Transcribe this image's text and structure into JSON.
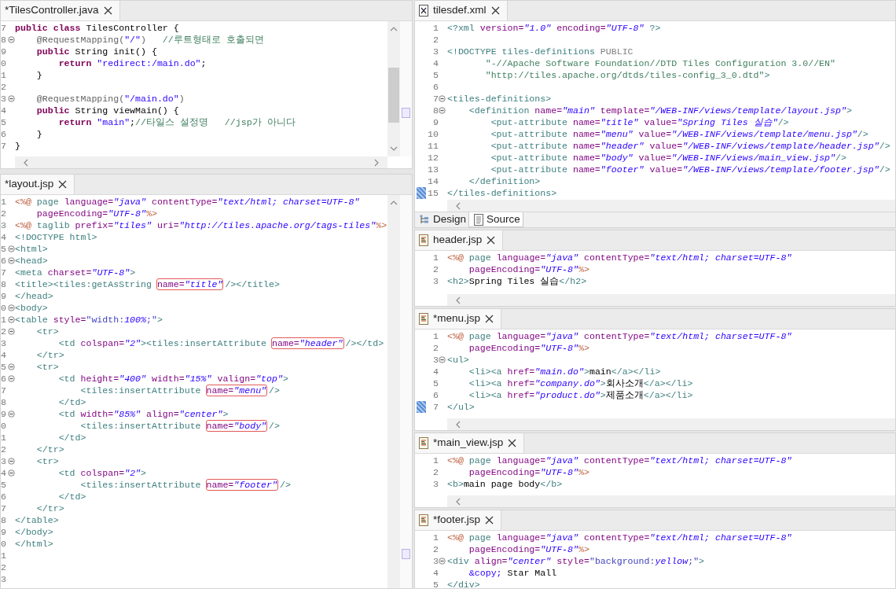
{
  "columns": [
    {
      "editors": [
        {
          "tab": {
            "label": "*TilesController.java"
          },
          "lines": [
            {
              "number": "7",
              "fold": false,
              "segs": [
                {
                  "text": "public class ",
                  "kind": "k"
                },
                {
                  "text": "TilesController {",
                  "kind": "p"
                }
              ]
            },
            {
              "number": "8",
              "fold": true,
              "segs": [
                {
                  "text": "    @RequestMapping(",
                  "kind": "an"
                },
                {
                  "text": "\"/\"",
                  "kind": "js"
                },
                {
                  "text": ")",
                  "kind": "an"
                },
                {
                  "text": "   //루트형태로 호출되면",
                  "kind": "c"
                }
              ]
            },
            {
              "number": "9",
              "fold": false,
              "segs": [
                {
                  "text": "    public",
                  "kind": "k"
                },
                {
                  "text": " String init() {",
                  "kind": "p"
                }
              ]
            },
            {
              "number": "0",
              "fold": false,
              "segs": [
                {
                  "text": "        return",
                  "kind": "k"
                },
                {
                  "text": " \"redirect:/main.do\"",
                  "kind": "js"
                },
                {
                  "text": ";",
                  "kind": "p"
                }
              ]
            },
            {
              "number": "1",
              "fold": false,
              "segs": [
                {
                  "text": "    }",
                  "kind": "p"
                }
              ]
            },
            {
              "number": "2",
              "fold": false
            },
            {
              "number": "3",
              "fold": true,
              "segs": [
                {
                  "text": "    @RequestMapping(",
                  "kind": "an"
                },
                {
                  "text": "\"/main.do\"",
                  "kind": "js"
                },
                {
                  "text": ")",
                  "kind": "an"
                }
              ]
            },
            {
              "number": "4",
              "fold": false,
              "segs": [
                {
                  "text": "    public",
                  "kind": "k"
                },
                {
                  "text": " String viewMain() {",
                  "kind": "p"
                }
              ]
            },
            {
              "number": "5",
              "fold": false,
              "segs": [
                {
                  "text": "        return",
                  "kind": "k"
                },
                {
                  "text": " \"main\"",
                  "kind": "js"
                },
                {
                  "text": ";",
                  "kind": "p"
                },
                {
                  "text": "//타일스 설정명   //jsp가 아니다",
                  "kind": "c"
                }
              ]
            },
            {
              "number": "6",
              "fold": false,
              "segs": [
                {
                  "text": "    }",
                  "kind": "p"
                }
              ]
            },
            {
              "number": "7",
              "fold": false,
              "segs": [
                {
                  "text": "}",
                  "kind": "p"
                }
              ]
            }
          ]
        },
        {
          "tab": {
            "label": "*layout.jsp"
          },
          "lines": [
            {
              "number": "1",
              "fold": false,
              "segs": [
                {
                  "text": "<%@ ",
                  "kind": "d"
                },
                {
                  "text": "page ",
                  "kind": "tag"
                },
                {
                  "text": "language=",
                  "kind": "at"
                },
                {
                  "text": "\"java\" ",
                  "kind": "s"
                },
                {
                  "text": "contentType=",
                  "kind": "at"
                },
                {
                  "text": "\"text/html; charset=UTF-8\"",
                  "kind": "s"
                }
              ]
            },
            {
              "number": "2",
              "fold": false,
              "segs": [
                {
                  "text": "    pageEncoding=",
                  "kind": "at"
                },
                {
                  "text": "\"UTF-8\"",
                  "kind": "s"
                },
                {
                  "text": "%>",
                  "kind": "d"
                }
              ]
            },
            {
              "number": "3",
              "fold": false,
              "segs": [
                {
                  "text": "<%@ ",
                  "kind": "d"
                },
                {
                  "text": "taglib ",
                  "kind": "tag"
                },
                {
                  "text": "prefix=",
                  "kind": "at"
                },
                {
                  "text": "\"tiles\" ",
                  "kind": "s"
                },
                {
                  "text": "uri=",
                  "kind": "at"
                },
                {
                  "text": "\"http://tiles.apache.org/tags-tiles\"",
                  "kind": "s"
                },
                {
                  "text": "%>",
                  "kind": "d"
                }
              ]
            },
            {
              "number": "4",
              "fold": false,
              "segs": [
                {
                  "text": "<!DOCTYPE html>",
                  "kind": "tag"
                }
              ]
            },
            {
              "number": "5",
              "fold": true,
              "segs": [
                {
                  "text": "<html>",
                  "kind": "tag"
                }
              ]
            },
            {
              "number": "6",
              "fold": true,
              "segs": [
                {
                  "text": "<head>",
                  "kind": "tag"
                }
              ]
            },
            {
              "number": "7",
              "fold": false,
              "segs": [
                {
                  "text": "<meta ",
                  "kind": "tag"
                },
                {
                  "text": "charset=",
                  "kind": "at"
                },
                {
                  "text": "\"UTF-8\"",
                  "kind": "s"
                },
                {
                  "text": ">",
                  "kind": "tag"
                }
              ]
            },
            {
              "number": "8",
              "fold": false,
              "segs": [
                {
                  "text": "<title><tiles:getAsString ",
                  "kind": "tag"
                },
                {
                  "kind": "box",
                  "segs": [
                    {
                      "text": "name=",
                      "kind": "at"
                    },
                    {
                      "text": "\"title\"",
                      "kind": "s"
                    }
                  ]
                },
                {
                  "text": "/></title>",
                  "kind": "tag"
                }
              ]
            },
            {
              "number": "9",
              "fold": false,
              "segs": [
                {
                  "text": "</head>",
                  "kind": "tag"
                }
              ]
            },
            {
              "number": "0",
              "fold": true,
              "segs": [
                {
                  "text": "<body>",
                  "kind": "tag"
                }
              ]
            },
            {
              "number": "1",
              "fold": true,
              "segs": [
                {
                  "text": "<table ",
                  "kind": "tag"
                },
                {
                  "text": "style=",
                  "kind": "at"
                },
                {
                  "text": "\"width:",
                  "kind": "sv"
                },
                {
                  "text": "100%",
                  "kind": "s"
                },
                {
                  "text": ";\"",
                  "kind": "sv"
                },
                {
                  "text": ">",
                  "kind": "tag"
                }
              ]
            },
            {
              "number": "2",
              "fold": true,
              "segs": [
                {
                  "text": "    <tr>",
                  "kind": "tag"
                }
              ]
            },
            {
              "number": "3",
              "fold": false,
              "segs": [
                {
                  "text": "        <td ",
                  "kind": "tag"
                },
                {
                  "text": "colspan=",
                  "kind": "at"
                },
                {
                  "text": "\"2\"",
                  "kind": "s"
                },
                {
                  "text": "><tiles:insertAttribute ",
                  "kind": "tag"
                },
                {
                  "kind": "box",
                  "segs": [
                    {
                      "text": "name=",
                      "kind": "at"
                    },
                    {
                      "text": "\"header\"",
                      "kind": "s"
                    }
                  ]
                },
                {
                  "text": "/></td>",
                  "kind": "tag"
                }
              ]
            },
            {
              "number": "4",
              "fold": false,
              "segs": [
                {
                  "text": "    </tr>",
                  "kind": "tag"
                }
              ]
            },
            {
              "number": "5",
              "fold": true,
              "segs": [
                {
                  "text": "    <tr>",
                  "kind": "tag"
                }
              ]
            },
            {
              "number": "6",
              "fold": true,
              "segs": [
                {
                  "text": "        <td ",
                  "kind": "tag"
                },
                {
                  "text": "height=",
                  "kind": "at"
                },
                {
                  "text": "\"400\" ",
                  "kind": "s"
                },
                {
                  "text": "width=",
                  "kind": "at"
                },
                {
                  "text": "\"15%\" ",
                  "kind": "s"
                },
                {
                  "text": "valign=",
                  "kind": "at"
                },
                {
                  "text": "\"top\"",
                  "kind": "s"
                },
                {
                  "text": ">",
                  "kind": "tag"
                }
              ]
            },
            {
              "number": "7",
              "fold": false,
              "segs": [
                {
                  "text": "            <tiles:insertAttribute ",
                  "kind": "tag"
                },
                {
                  "kind": "box",
                  "segs": [
                    {
                      "text": "name=",
                      "kind": "at"
                    },
                    {
                      "text": "\"menu\"",
                      "kind": "s"
                    }
                  ]
                },
                {
                  "text": "/>",
                  "kind": "tag"
                }
              ]
            },
            {
              "number": "8",
              "fold": false,
              "segs": [
                {
                  "text": "        </td>",
                  "kind": "tag"
                }
              ]
            },
            {
              "number": "9",
              "fold": true,
              "segs": [
                {
                  "text": "        <td ",
                  "kind": "tag"
                },
                {
                  "text": "width=",
                  "kind": "at"
                },
                {
                  "text": "\"85%\" ",
                  "kind": "s"
                },
                {
                  "text": "align=",
                  "kind": "at"
                },
                {
                  "text": "\"center\"",
                  "kind": "s"
                },
                {
                  "text": ">",
                  "kind": "tag"
                }
              ]
            },
            {
              "number": "0",
              "fold": false,
              "segs": [
                {
                  "text": "            <tiles:insertAttribute ",
                  "kind": "tag"
                },
                {
                  "kind": "box",
                  "segs": [
                    {
                      "text": "name=",
                      "kind": "at"
                    },
                    {
                      "text": "\"body\"",
                      "kind": "s"
                    }
                  ]
                },
                {
                  "text": "/>",
                  "kind": "tag"
                }
              ]
            },
            {
              "number": "1",
              "fold": false,
              "segs": [
                {
                  "text": "        </td>",
                  "kind": "tag"
                }
              ]
            },
            {
              "number": "2",
              "fold": false,
              "segs": [
                {
                  "text": "    </tr>",
                  "kind": "tag"
                }
              ]
            },
            {
              "number": "3",
              "fold": true,
              "segs": [
                {
                  "text": "    <tr>",
                  "kind": "tag"
                }
              ]
            },
            {
              "number": "4",
              "fold": true,
              "segs": [
                {
                  "text": "        <td ",
                  "kind": "tag"
                },
                {
                  "text": "colspan=",
                  "kind": "at"
                },
                {
                  "text": "\"2\"",
                  "kind": "s"
                },
                {
                  "text": ">",
                  "kind": "tag"
                }
              ]
            },
            {
              "number": "5",
              "fold": false,
              "segs": [
                {
                  "text": "            <tiles:insertAttribute ",
                  "kind": "tag"
                },
                {
                  "kind": "box",
                  "segs": [
                    {
                      "text": "name=",
                      "kind": "at"
                    },
                    {
                      "text": "\"footer\"",
                      "kind": "s"
                    }
                  ]
                },
                {
                  "text": "/>",
                  "kind": "tag"
                }
              ]
            },
            {
              "number": "6",
              "fold": false,
              "segs": [
                {
                  "text": "        </td>",
                  "kind": "tag"
                }
              ]
            },
            {
              "number": "7",
              "fold": false,
              "segs": [
                {
                  "text": "    </tr>",
                  "kind": "tag"
                }
              ]
            },
            {
              "number": "8",
              "fold": false,
              "segs": [
                {
                  "text": "</table>",
                  "kind": "tag"
                }
              ]
            },
            {
              "number": "9",
              "fold": false,
              "segs": [
                {
                  "text": "</body>",
                  "kind": "tag"
                }
              ]
            },
            {
              "number": "0",
              "fold": false,
              "segs": [
                {
                  "text": "</html>",
                  "kind": "tag"
                }
              ]
            },
            {
              "number": "1",
              "fold": false
            },
            {
              "number": "2",
              "fold": false
            },
            {
              "number": "3",
              "fold": false
            }
          ]
        }
      ]
    },
    {
      "editors": [
        {
          "tab": {
            "label": "tilesdef.xml"
          },
          "lines": [
            {
              "number": "1",
              "fold": false,
              "changed": false,
              "segs": [
                {
                  "text": "<?xml ",
                  "kind": "tag"
                },
                {
                  "text": "version=",
                  "kind": "at"
                },
                {
                  "text": "\"1.0\" ",
                  "kind": "s"
                },
                {
                  "text": "encoding=",
                  "kind": "at"
                },
                {
                  "text": "\"UTF-8\" ",
                  "kind": "s"
                },
                {
                  "text": "?>",
                  "kind": "tag"
                }
              ]
            },
            {
              "number": "2",
              "fold": false,
              "changed": false
            },
            {
              "number": "3",
              "fold": false,
              "changed": false,
              "segs": [
                {
                  "text": "<!DOCTYPE tiles-definitions ",
                  "kind": "tag"
                },
                {
                  "text": "PUBLIC",
                  "kind": "g"
                }
              ]
            },
            {
              "number": "4",
              "fold": false,
              "changed": false,
              "segs": [
                {
                  "text": "       \"-//Apache Software Foundation//DTD Tiles Configuration 3.0//EN\"",
                  "kind": "dt"
                }
              ]
            },
            {
              "number": "5",
              "fold": false,
              "changed": false,
              "segs": [
                {
                  "text": "       \"http://tiles.apache.org/dtds/tiles-config_3_0.dtd\"",
                  "kind": "dt"
                },
                {
                  "text": ">",
                  "kind": "tag"
                }
              ]
            },
            {
              "number": "6",
              "fold": false,
              "changed": false
            },
            {
              "number": "7",
              "fold": true,
              "changed": false,
              "segs": [
                {
                  "text": "<tiles-definitions>",
                  "kind": "tag"
                }
              ]
            },
            {
              "number": "8",
              "fold": true,
              "changed": false,
              "segs": [
                {
                  "text": "    <definition ",
                  "kind": "tag"
                },
                {
                  "text": "name=",
                  "kind": "at"
                },
                {
                  "text": "\"main\" ",
                  "kind": "s"
                },
                {
                  "text": "template=",
                  "kind": "at"
                },
                {
                  "text": "\"/WEB-INF/views/template/layout.jsp\"",
                  "kind": "s"
                },
                {
                  "text": ">",
                  "kind": "tag"
                }
              ]
            },
            {
              "number": "9",
              "fold": false,
              "changed": false,
              "segs": [
                {
                  "text": "        <put-attribute ",
                  "kind": "tag"
                },
                {
                  "text": "name=",
                  "kind": "at"
                },
                {
                  "text": "\"title\" ",
                  "kind": "s"
                },
                {
                  "text": "value=",
                  "kind": "at"
                },
                {
                  "text": "\"Spring Tiles 실습\"",
                  "kind": "s"
                },
                {
                  "text": "/>",
                  "kind": "tag"
                }
              ]
            },
            {
              "number": "10",
              "fold": false,
              "changed": false,
              "segs": [
                {
                  "text": "        <put-attribute ",
                  "kind": "tag"
                },
                {
                  "text": "name=",
                  "kind": "at"
                },
                {
                  "text": "\"menu\" ",
                  "kind": "s"
                },
                {
                  "text": "value=",
                  "kind": "at"
                },
                {
                  "text": "\"/WEB-INF/views/template/menu.jsp\"",
                  "kind": "s"
                },
                {
                  "text": "/>",
                  "kind": "tag"
                }
              ]
            },
            {
              "number": "11",
              "fold": false,
              "changed": false,
              "segs": [
                {
                  "text": "        <put-attribute ",
                  "kind": "tag"
                },
                {
                  "text": "name=",
                  "kind": "at"
                },
                {
                  "text": "\"header\" ",
                  "kind": "s"
                },
                {
                  "text": "value=",
                  "kind": "at"
                },
                {
                  "text": "\"/WEB-INF/views/template/header.jsp\"",
                  "kind": "s"
                },
                {
                  "text": "/>",
                  "kind": "tag"
                }
              ]
            },
            {
              "number": "12",
              "fold": false,
              "changed": false,
              "segs": [
                {
                  "text": "        <put-attribute ",
                  "kind": "tag"
                },
                {
                  "text": "name=",
                  "kind": "at"
                },
                {
                  "text": "\"body\" ",
                  "kind": "s"
                },
                {
                  "text": "value=",
                  "kind": "at"
                },
                {
                  "text": "\"/WEB-INF/views/main_view.jsp\"",
                  "kind": "s"
                },
                {
                  "text": "/>",
                  "kind": "tag"
                }
              ]
            },
            {
              "number": "13",
              "fold": false,
              "changed": false,
              "segs": [
                {
                  "text": "        <put-attribute ",
                  "kind": "tag"
                },
                {
                  "text": "name=",
                  "kind": "at"
                },
                {
                  "text": "\"footer\" ",
                  "kind": "s"
                },
                {
                  "text": "value=",
                  "kind": "at"
                },
                {
                  "text": "\"/WEB-INF/views/template/footer.jsp\"",
                  "kind": "s"
                },
                {
                  "text": "/>",
                  "kind": "tag"
                }
              ]
            },
            {
              "number": "14",
              "fold": false,
              "changed": false,
              "segs": [
                {
                  "text": "    </definition>",
                  "kind": "tag"
                }
              ]
            },
            {
              "number": "15",
              "fold": false,
              "changed": true,
              "segs": [
                {
                  "text": "</tiles-definitions>",
                  "kind": "tag"
                }
              ]
            }
          ],
          "page_tabs": [
            {
              "label": "Design",
              "selected": false
            },
            {
              "label": "Source",
              "selected": true
            }
          ]
        },
        {
          "tab": {
            "label": "header.jsp"
          },
          "lines": [
            {
              "number": "1",
              "fold": false,
              "changed": false,
              "segs": [
                {
                  "text": "<%@ ",
                  "kind": "d"
                },
                {
                  "text": "page ",
                  "kind": "tag"
                },
                {
                  "text": "language=",
                  "kind": "at"
                },
                {
                  "text": "\"java\" ",
                  "kind": "s"
                },
                {
                  "text": "contentType=",
                  "kind": "at"
                },
                {
                  "text": "\"text/html; charset=UTF-8\"",
                  "kind": "s"
                }
              ]
            },
            {
              "number": "2",
              "fold": false,
              "changed": false,
              "segs": [
                {
                  "text": "    pageEncoding=",
                  "kind": "at"
                },
                {
                  "text": "\"UTF-8\"",
                  "kind": "s"
                },
                {
                  "text": "%>",
                  "kind": "d"
                }
              ]
            },
            {
              "number": "3",
              "fold": false,
              "changed": false,
              "segs": [
                {
                  "text": "<h2>",
                  "kind": "tag"
                },
                {
                  "text": "Spring Tiles 실습",
                  "kind": "p"
                },
                {
                  "text": "</h2>",
                  "kind": "tag"
                }
              ]
            }
          ]
        },
        {
          "tab": {
            "label": "*menu.jsp"
          },
          "lines": [
            {
              "number": "1",
              "fold": false,
              "changed": false,
              "segs": [
                {
                  "text": "<%@ ",
                  "kind": "d"
                },
                {
                  "text": "page ",
                  "kind": "tag"
                },
                {
                  "text": "language=",
                  "kind": "at"
                },
                {
                  "text": "\"java\" ",
                  "kind": "s"
                },
                {
                  "text": "contentType=",
                  "kind": "at"
                },
                {
                  "text": "\"text/html; charset=UTF-8\"",
                  "kind": "s"
                }
              ]
            },
            {
              "number": "2",
              "fold": false,
              "changed": false,
              "segs": [
                {
                  "text": "    pageEncoding=",
                  "kind": "at"
                },
                {
                  "text": "\"UTF-8\"",
                  "kind": "s"
                },
                {
                  "text": "%>",
                  "kind": "d"
                }
              ]
            },
            {
              "number": "3",
              "fold": true,
              "changed": false,
              "segs": [
                {
                  "text": "<ul>",
                  "kind": "tag"
                }
              ]
            },
            {
              "number": "4",
              "fold": false,
              "changed": false,
              "segs": [
                {
                  "text": "    <li><a ",
                  "kind": "tag"
                },
                {
                  "text": "href=",
                  "kind": "at"
                },
                {
                  "text": "\"main.do\"",
                  "kind": "s"
                },
                {
                  "text": ">",
                  "kind": "tag"
                },
                {
                  "text": "main",
                  "kind": "p"
                },
                {
                  "text": "</a></li>",
                  "kind": "tag"
                }
              ]
            },
            {
              "number": "5",
              "fold": false,
              "changed": false,
              "segs": [
                {
                  "text": "    <li><a ",
                  "kind": "tag"
                },
                {
                  "text": "href=",
                  "kind": "at"
                },
                {
                  "text": "\"company.do\"",
                  "kind": "s"
                },
                {
                  "text": ">",
                  "kind": "tag"
                },
                {
                  "text": "회사소개",
                  "kind": "p"
                },
                {
                  "text": "</a></li>",
                  "kind": "tag"
                }
              ]
            },
            {
              "number": "6",
              "fold": false,
              "changed": false,
              "segs": [
                {
                  "text": "    <li><a ",
                  "kind": "tag"
                },
                {
                  "text": "href=",
                  "kind": "at"
                },
                {
                  "text": "\"product.do\"",
                  "kind": "s"
                },
                {
                  "text": ">",
                  "kind": "tag"
                },
                {
                  "text": "제품소개",
                  "kind": "p"
                },
                {
                  "text": "</a></li>",
                  "kind": "tag"
                }
              ]
            },
            {
              "number": "7",
              "fold": false,
              "changed": true,
              "segs": [
                {
                  "text": "</ul>",
                  "kind": "tag"
                }
              ]
            }
          ]
        },
        {
          "tab": {
            "label": "*main_view.jsp"
          },
          "lines": [
            {
              "number": "1",
              "fold": false,
              "changed": false,
              "segs": [
                {
                  "text": "<%@ ",
                  "kind": "d"
                },
                {
                  "text": "page ",
                  "kind": "tag"
                },
                {
                  "text": "language=",
                  "kind": "at"
                },
                {
                  "text": "\"java\" ",
                  "kind": "s"
                },
                {
                  "text": "contentType=",
                  "kind": "at"
                },
                {
                  "text": "\"text/html; charset=UTF-8\"",
                  "kind": "s"
                }
              ]
            },
            {
              "number": "2",
              "fold": false,
              "changed": false,
              "segs": [
                {
                  "text": "    pageEncoding=",
                  "kind": "at"
                },
                {
                  "text": "\"UTF-8\"",
                  "kind": "s"
                },
                {
                  "text": "%>",
                  "kind": "d"
                }
              ]
            },
            {
              "number": "3",
              "fold": false,
              "changed": false,
              "segs": [
                {
                  "text": "<b>",
                  "kind": "tag"
                },
                {
                  "text": "main page body",
                  "kind": "p"
                },
                {
                  "text": "</b>",
                  "kind": "tag"
                }
              ]
            }
          ]
        },
        {
          "tab": {
            "label": "*footer.jsp"
          },
          "lines": [
            {
              "number": "1",
              "fold": false,
              "changed": false,
              "segs": [
                {
                  "text": "<%@ ",
                  "kind": "d"
                },
                {
                  "text": "page ",
                  "kind": "tag"
                },
                {
                  "text": "language=",
                  "kind": "at"
                },
                {
                  "text": "\"java\" ",
                  "kind": "s"
                },
                {
                  "text": "contentType=",
                  "kind": "at"
                },
                {
                  "text": "\"text/html; charset=UTF-8\"",
                  "kind": "s"
                }
              ]
            },
            {
              "number": "2",
              "fold": false,
              "changed": false,
              "segs": [
                {
                  "text": "    pageEncoding=",
                  "kind": "at"
                },
                {
                  "text": "\"UTF-8\"",
                  "kind": "s"
                },
                {
                  "text": "%>",
                  "kind": "d"
                }
              ]
            },
            {
              "number": "3",
              "fold": true,
              "changed": false,
              "segs": [
                {
                  "text": "<div ",
                  "kind": "tag"
                },
                {
                  "text": "align=",
                  "kind": "at"
                },
                {
                  "text": "\"center\" ",
                  "kind": "s"
                },
                {
                  "text": "style=",
                  "kind": "at"
                },
                {
                  "text": "\"background:",
                  "kind": "sv"
                },
                {
                  "text": "yellow",
                  "kind": "s"
                },
                {
                  "text": ";\"",
                  "kind": "sv"
                },
                {
                  "text": ">",
                  "kind": "tag"
                }
              ]
            },
            {
              "number": "4",
              "fold": false,
              "changed": false,
              "segs": [
                {
                  "text": "    &copy;",
                  "kind": "ent"
                },
                {
                  "text": " Star Mall",
                  "kind": "p"
                }
              ]
            },
            {
              "number": "5",
              "fold": false,
              "changed": false,
              "segs": [
                {
                  "text": "</div>",
                  "kind": "tag"
                }
              ]
            }
          ]
        }
      ]
    }
  ]
}
